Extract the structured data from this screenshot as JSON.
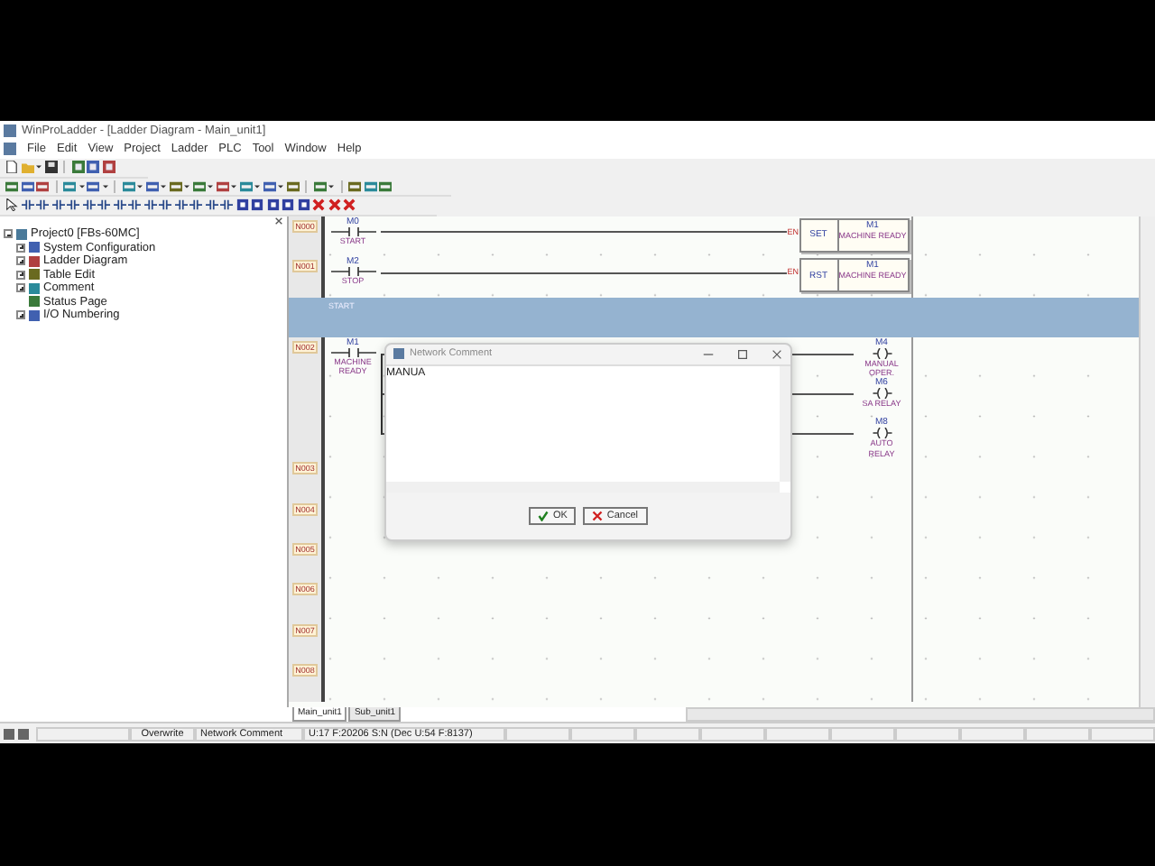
{
  "window": {
    "title": "WinProLadder - [Ladder Diagram - Main_unit1]"
  },
  "menu": [
    "File",
    "Edit",
    "View",
    "Project",
    "Ladder",
    "PLC",
    "Tool",
    "Window",
    "Help"
  ],
  "tree": {
    "label": "Project0 [FBs-60MC]",
    "expanded": true,
    "children": [
      {
        "label": "System Configuration",
        "kind": "folder"
      },
      {
        "label": "Ladder Diagram",
        "kind": "folder"
      },
      {
        "label": "Table Edit",
        "kind": "folder"
      },
      {
        "label": "Comment",
        "kind": "folder"
      },
      {
        "label": "Status Page",
        "kind": "leaf"
      },
      {
        "label": "I/O Numbering",
        "kind": "folder"
      }
    ]
  },
  "rungs": [
    {
      "number": "N000",
      "contact": {
        "address": "M0",
        "label": "START"
      },
      "outputs": [
        {
          "kind": "function",
          "enable": "EN",
          "op": "SET",
          "address": "M1",
          "label": "MACHINE READY"
        }
      ]
    },
    {
      "number": "N001",
      "contact": {
        "address": "M2",
        "label": "STOP"
      },
      "outputs": [
        {
          "kind": "function",
          "enable": "EN",
          "op": "RST",
          "address": "M1",
          "label": "MACHINE READY"
        }
      ]
    },
    {
      "number": "N002",
      "comment": "START",
      "contact": {
        "address": "M1",
        "label": "MACHINE READY"
      },
      "outputs": [
        {
          "kind": "coil",
          "address": "M4",
          "label": "MANUAL OPER."
        },
        {
          "kind": "coil",
          "address": "M6",
          "label": "SA RELAY"
        },
        {
          "kind": "coil",
          "address": "M8",
          "label": "AUTO RELAY"
        }
      ]
    },
    {
      "number": "N003"
    },
    {
      "number": "N004"
    },
    {
      "number": "N005"
    },
    {
      "number": "N006"
    },
    {
      "number": "N007"
    },
    {
      "number": "N008"
    }
  ],
  "dialog": {
    "title": "Network Comment",
    "value": "MANUA",
    "buttons": [
      {
        "label": "OK",
        "kind": "ok"
      },
      {
        "label": "Cancel",
        "kind": "cancel"
      }
    ]
  },
  "sheet_tabs": [
    {
      "label": "Main_unit1",
      "selected": true
    },
    {
      "label": "Sub_unit1",
      "selected": false
    }
  ],
  "status_bar": [
    "Overwrite",
    "Network Comment",
    "U:17 F:20206 S:N (Dec U:54 F:8137)"
  ]
}
